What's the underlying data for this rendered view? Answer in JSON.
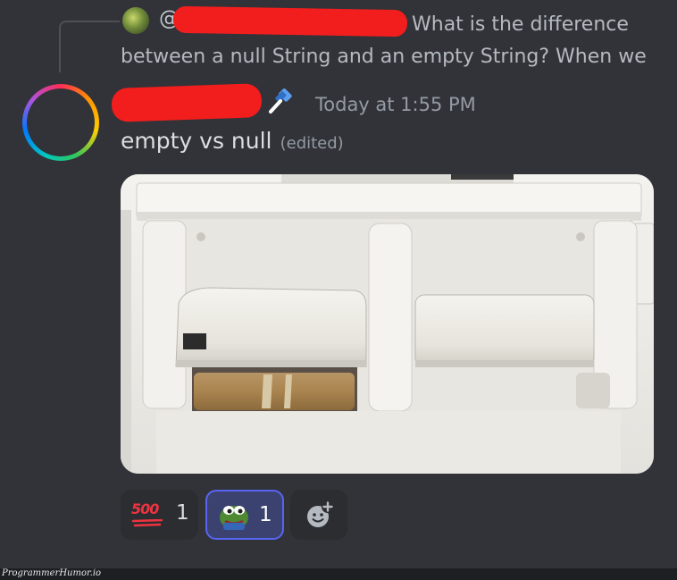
{
  "reply": {
    "at_symbol": "@",
    "text": "What is the difference between a null String and an empty String? When we"
  },
  "message": {
    "timestamp": "Today at 1:55 PM",
    "text": "empty vs null",
    "edited_label": "(edited)"
  },
  "reactions": [
    {
      "emoji": "100-icon",
      "glyph": "500",
      "count": "1",
      "selected": false
    },
    {
      "emoji": "pepe-frog-icon",
      "count": "1",
      "selected": true
    },
    {
      "emoji": "add-reaction-icon"
    }
  ],
  "colors": {
    "background": "#313338",
    "selected_reaction_border": "#5865f2",
    "redaction": "#f21d1d"
  },
  "watermark": "ProgrammerHumor.io"
}
